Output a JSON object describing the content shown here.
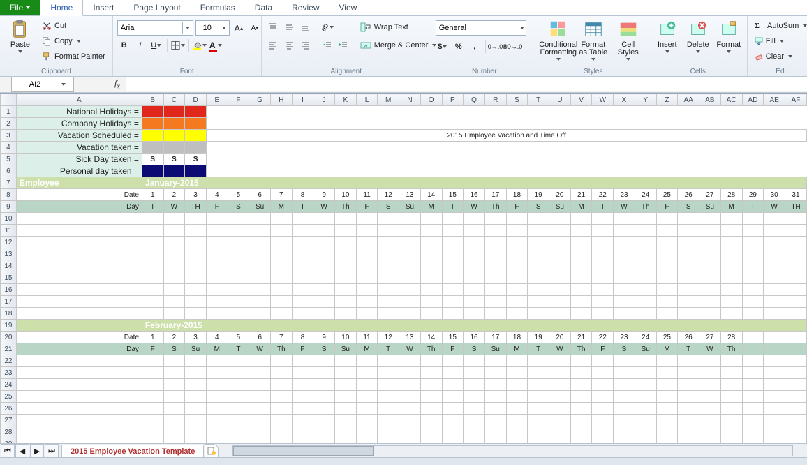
{
  "tabs": {
    "file": "File",
    "home": "Home",
    "insert": "Insert",
    "page_layout": "Page Layout",
    "formulas": "Formulas",
    "data": "Data",
    "review": "Review",
    "view": "View"
  },
  "ribbon": {
    "clipboard": {
      "label": "Clipboard",
      "paste": "Paste",
      "cut": "Cut",
      "copy": "Copy",
      "format_painter": "Format Painter"
    },
    "font": {
      "label": "Font",
      "name": "Arial",
      "size": "10"
    },
    "alignment": {
      "label": "Alignment",
      "wrap": "Wrap Text",
      "merge": "Merge & Center"
    },
    "number": {
      "label": "Number",
      "format": "General"
    },
    "styles": {
      "label": "Styles",
      "conditional": "Conditional Formatting",
      "as_table": "Format as Table",
      "cell_styles": "Cell Styles"
    },
    "cells": {
      "label": "Cells",
      "insert": "Insert",
      "delete": "Delete",
      "format": "Format"
    },
    "editing": {
      "label": "Edi",
      "autosum": "AutoSum",
      "fill": "Fill",
      "clear": "Clear"
    }
  },
  "namebox": "AI2",
  "formula": "",
  "columns": [
    "A",
    "B",
    "C",
    "D",
    "E",
    "F",
    "G",
    "H",
    "I",
    "J",
    "K",
    "L",
    "M",
    "N",
    "O",
    "P",
    "Q",
    "R",
    "S",
    "T",
    "U",
    "V",
    "W",
    "X",
    "Y",
    "Z",
    "AA",
    "AB",
    "AC",
    "AD",
    "AE",
    "AF"
  ],
  "legend": [
    {
      "label": "National Holidays =",
      "bg": "#e1261c",
      "text": ""
    },
    {
      "label": "Company Holidays =",
      "bg": "#f57a1f",
      "text": ""
    },
    {
      "label": "Vacation Scheduled =",
      "bg": "#ffff00",
      "text": ""
    },
    {
      "label": "Vacation taken =",
      "bg": "#bfbfbf",
      "text": ""
    },
    {
      "label": "Sick Day taken =",
      "bg": "#ffffff",
      "text": "S"
    },
    {
      "label": "Personal day taken =",
      "bg": "#0b0b73",
      "text": ""
    }
  ],
  "title": "2015 Employee Vacation and Time Off",
  "employee_hdr": "Employee",
  "months": [
    {
      "name": "January-2015",
      "date_label": "Date",
      "day_label": "Day",
      "dates": [
        "1",
        "2",
        "3",
        "4",
        "5",
        "6",
        "7",
        "8",
        "9",
        "10",
        "11",
        "12",
        "13",
        "14",
        "15",
        "16",
        "17",
        "18",
        "19",
        "20",
        "21",
        "22",
        "23",
        "24",
        "25",
        "26",
        "27",
        "28",
        "29",
        "30",
        "31"
      ],
      "days": [
        "T",
        "W",
        "TH",
        "F",
        "S",
        "Su",
        "M",
        "T",
        "W",
        "Th",
        "F",
        "S",
        "Su",
        "M",
        "T",
        "W",
        "Th",
        "F",
        "S",
        "Su",
        "M",
        "T",
        "W",
        "Th",
        "F",
        "S",
        "Su",
        "M",
        "T",
        "W",
        "TH"
      ],
      "blank_rows": 9
    },
    {
      "name": "February-2015",
      "date_label": "Date",
      "day_label": "Day",
      "dates": [
        "1",
        "2",
        "3",
        "4",
        "5",
        "6",
        "7",
        "8",
        "9",
        "10",
        "11",
        "12",
        "13",
        "14",
        "15",
        "16",
        "17",
        "18",
        "19",
        "20",
        "21",
        "22",
        "23",
        "24",
        "25",
        "26",
        "27",
        "28",
        "",
        "",
        ""
      ],
      "days": [
        "F",
        "S",
        "Su",
        "M",
        "T",
        "W",
        "Th",
        "F",
        "S",
        "Su",
        "M",
        "T",
        "W",
        "Th",
        "F",
        "S",
        "Su",
        "M",
        "T",
        "W",
        "Th",
        "F",
        "S",
        "Su",
        "M",
        "T",
        "W",
        "Th",
        "",
        "",
        ""
      ],
      "blank_rows": 8
    }
  ],
  "sheet_tab": "2015 Employee Vacation Template"
}
